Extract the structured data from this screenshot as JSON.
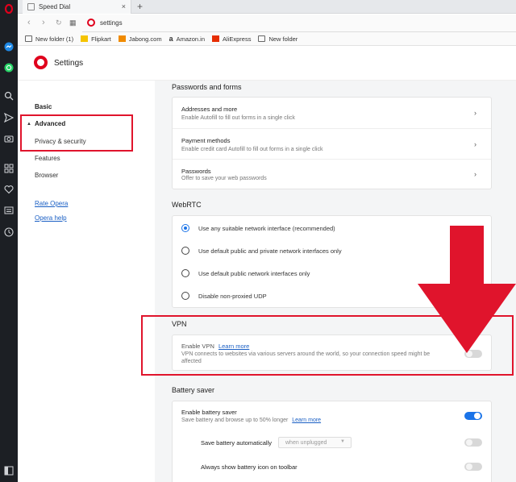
{
  "browser": {
    "tab_title": "Speed Dial",
    "tab_close": "×",
    "new_tab": "+",
    "address": "settings",
    "bookmarks": [
      {
        "label": "New folder (1)",
        "icon": "folder-icon"
      },
      {
        "label": "Flipkart",
        "icon": "flipkart-icon"
      },
      {
        "label": "Jabong.com",
        "icon": "jabong-icon"
      },
      {
        "label": "Amazon.in",
        "icon": "amazon-icon"
      },
      {
        "label": "AliExpress",
        "icon": "aliexpress-icon"
      },
      {
        "label": "New folder",
        "icon": "folder-icon"
      }
    ]
  },
  "settings": {
    "title": "Settings",
    "nav": {
      "basic": "Basic",
      "advanced": "Advanced",
      "privacy": "Privacy & security",
      "features": "Features",
      "browser": "Browser",
      "rate": "Rate Opera",
      "help": "Opera help"
    },
    "passwords": {
      "section_title": "Passwords and forms",
      "rows": [
        {
          "title": "Addresses and more",
          "sub": "Enable Autofill to fill out forms in a single click"
        },
        {
          "title": "Payment methods",
          "sub": "Enable credit card Autofill to fill out forms in a single click"
        },
        {
          "title": "Passwords",
          "sub": "Offer to save your web passwords"
        }
      ]
    },
    "webrtc": {
      "section_title": "WebRTC",
      "options": [
        {
          "label": "Use any suitable network interface (recommended)",
          "selected": true
        },
        {
          "label": "Use default public and private network interfaces only",
          "selected": false
        },
        {
          "label": "Use default public network interfaces only",
          "selected": false
        },
        {
          "label": "Disable non-proxied UDP",
          "selected": false
        }
      ]
    },
    "vpn": {
      "section_title": "VPN",
      "enable_label": "Enable VPN",
      "learn_more": "Learn more",
      "description": "VPN connects to websites via various servers around the world, so your connection speed might be affected",
      "enabled": false
    },
    "battery": {
      "section_title": "Battery saver",
      "enable_label": "Enable battery saver",
      "enable_sub": "Save battery and browse up to 50% longer",
      "learn_more": "Learn more",
      "enabled": true,
      "auto_label": "Save battery automatically",
      "auto_select": "when unplugged",
      "auto_enabled": false,
      "show_icon_label": "Always show battery icon on toolbar",
      "show_icon_enabled": false
    }
  },
  "colors": {
    "opera_red": "#e0001c",
    "annotation_red": "#e0142c",
    "accent_blue": "#1a73e8"
  }
}
